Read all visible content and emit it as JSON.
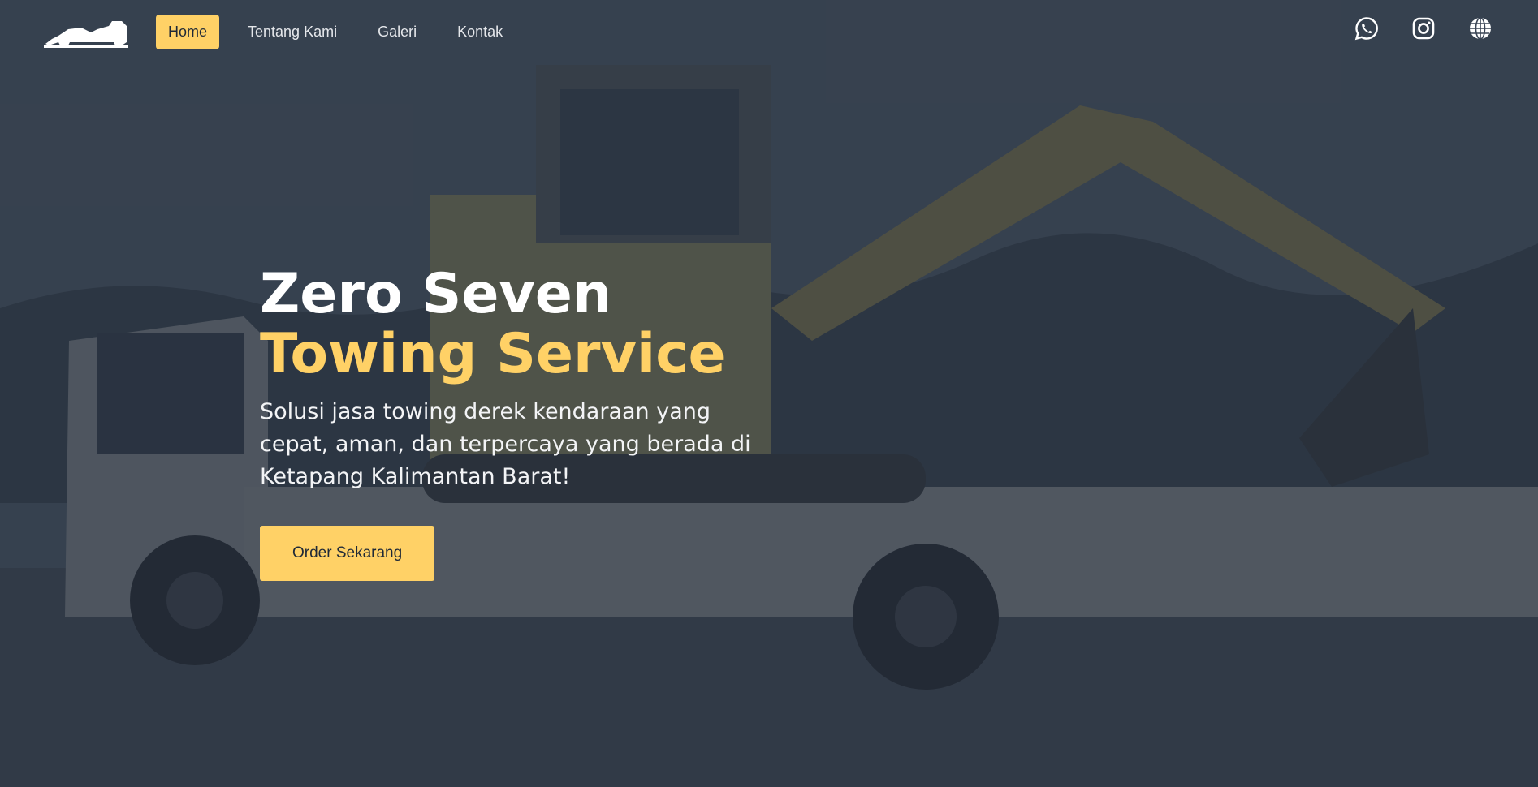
{
  "nav": {
    "logo_icon": "tow-truck-logo-icon",
    "items": [
      {
        "label": "Home",
        "active": true
      },
      {
        "label": "Tentang Kami",
        "active": false
      },
      {
        "label": "Galeri",
        "active": false
      },
      {
        "label": "Kontak",
        "active": false
      }
    ],
    "social_icons": [
      "whatsapp-icon",
      "instagram-icon",
      "globe-icon"
    ]
  },
  "hero": {
    "title_line_1": "Zero Seven",
    "title_line_2": "Towing Service",
    "description": "Solusi jasa towing derek kendaraan yang cepat, aman, dan terpercaya yang berada di Ketapang Kalimantan Barat!",
    "cta_label": "Order Sekarang"
  },
  "colors": {
    "accent": "#ffd166",
    "overlay": "#1e2634",
    "text_light": "#ffffff"
  }
}
